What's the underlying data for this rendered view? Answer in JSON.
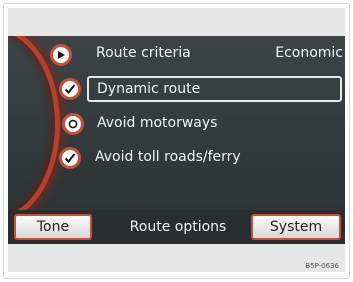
{
  "menu": {
    "items": [
      {
        "label": "Route criteria",
        "value": "Economic",
        "icon": "play-icon"
      },
      {
        "label": "Dynamic route",
        "icon": "checked-circle-icon",
        "selected": true
      },
      {
        "label": "Avoid motorways",
        "icon": "unchecked-circle-icon"
      },
      {
        "label": "Avoid toll roads/ferry",
        "icon": "checked-circle-icon"
      }
    ]
  },
  "tabs": {
    "left": "Tone",
    "center": "Route options",
    "right": "System"
  },
  "footer": {
    "code": "B5P-0636"
  },
  "colors": {
    "accent": "#c4513c",
    "screen_bg": "#3a3f41",
    "text": "#f2f2f2"
  }
}
